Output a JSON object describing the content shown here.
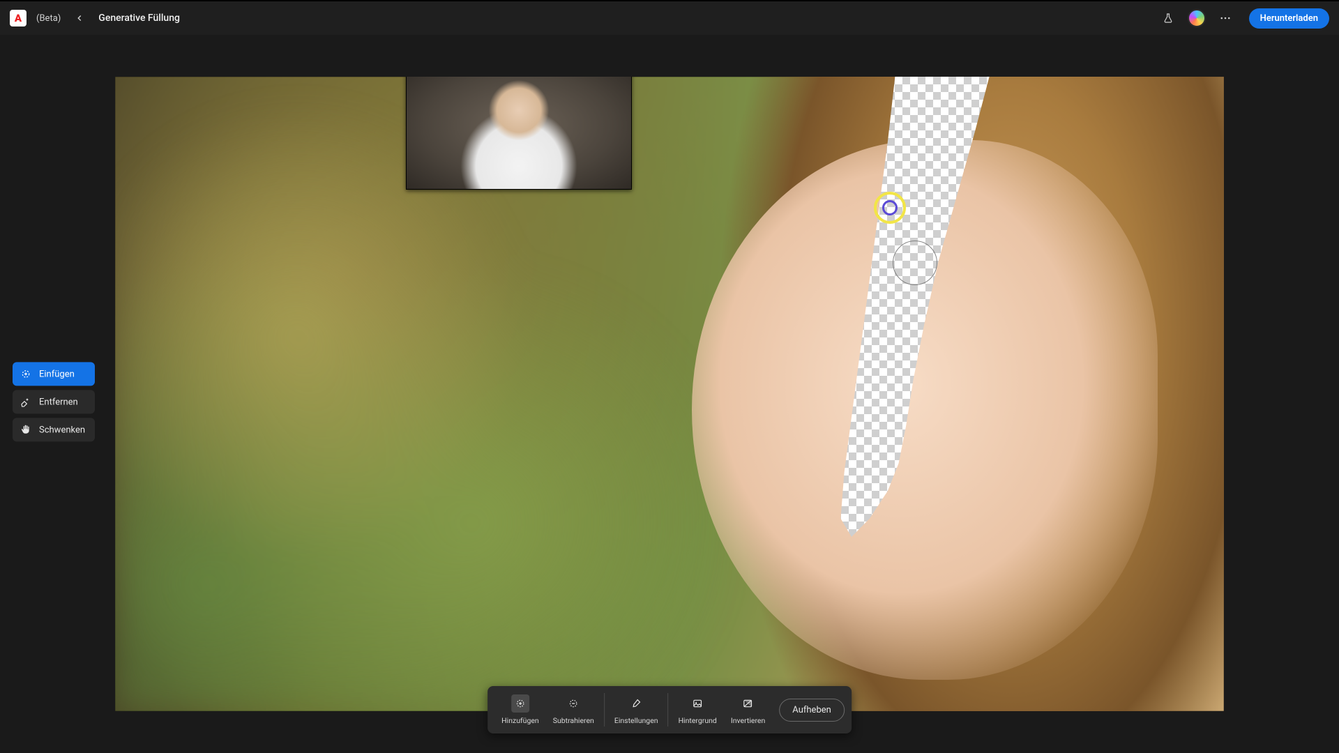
{
  "header": {
    "beta_tag": "(Beta)",
    "title": "Generative Füllung",
    "download_label": "Herunterladen"
  },
  "tools": {
    "insert": {
      "label": "Einfügen",
      "active": true
    },
    "remove": {
      "label": "Entfernen",
      "active": false
    },
    "pan": {
      "label": "Schwenken",
      "active": false
    }
  },
  "bottom_bar": {
    "add": "Hinzufügen",
    "subtract": "Subtrahieren",
    "settings": "Einstellungen",
    "background": "Hintergrund",
    "invert": "Invertieren",
    "cancel": "Aufheben"
  }
}
